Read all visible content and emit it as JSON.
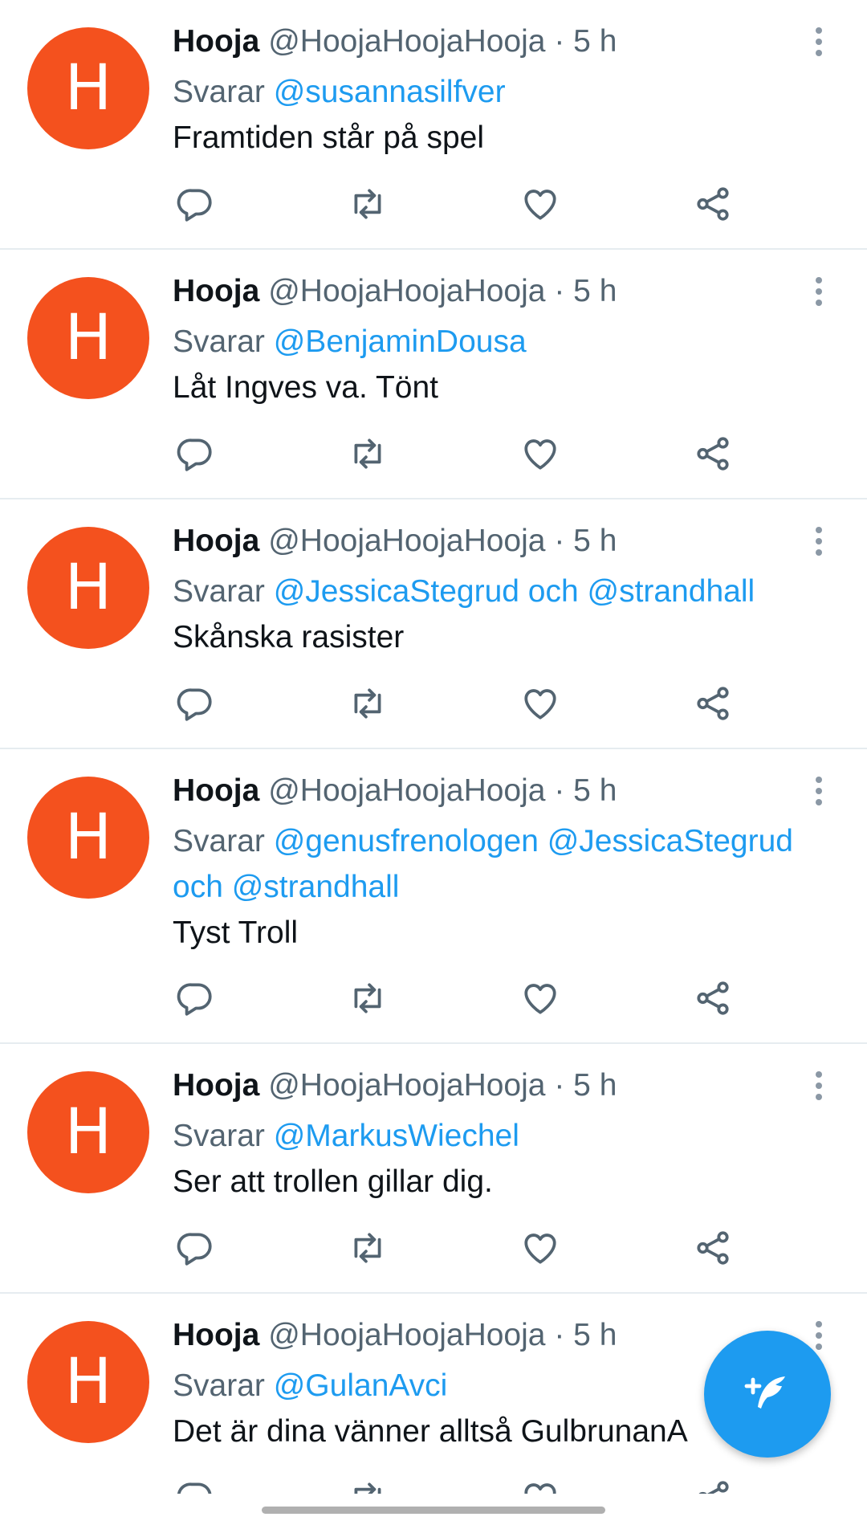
{
  "colors": {
    "avatar_bg": "#f4511e",
    "mention": "#1d9bf0",
    "secondary_text": "#536471",
    "primary_text": "#0f1419",
    "fab_bg": "#1d9bf0"
  },
  "reply_prefix": "Svarar",
  "tweets": [
    {
      "avatar_letter": "H",
      "display_name": "Hooja",
      "handle": "@HoojaHoojaHooja",
      "separator": "·",
      "time": "5 h",
      "replying_to": "@susannasilfver",
      "text": "Framtiden står på spel"
    },
    {
      "avatar_letter": "H",
      "display_name": "Hooja",
      "handle": "@HoojaHoojaHooja",
      "separator": "·",
      "time": "5 h",
      "replying_to": "@BenjaminDousa",
      "text": "Låt Ingves va. Tönt"
    },
    {
      "avatar_letter": "H",
      "display_name": "Hooja",
      "handle": "@HoojaHoojaHooja",
      "separator": "·",
      "time": "5 h",
      "replying_to": "@JessicaStegrud och @strandhall",
      "text": "Skånska rasister"
    },
    {
      "avatar_letter": "H",
      "display_name": "Hooja",
      "handle": "@HoojaHoojaHooja",
      "separator": "·",
      "time": "5 h",
      "replying_to": "@genusfrenologen @JessicaStegrud och @strandhall",
      "text": "Tyst Troll"
    },
    {
      "avatar_letter": "H",
      "display_name": "Hooja",
      "handle": "@HoojaHoojaHooja",
      "separator": "·",
      "time": "5 h",
      "replying_to": "@MarkusWiechel",
      "text": "Ser att trollen gillar dig."
    },
    {
      "avatar_letter": "H",
      "display_name": "Hooja",
      "handle": "@HoojaHoojaHooja",
      "separator": "·",
      "time": "5 h",
      "replying_to": "@GulanAvci",
      "text": "Det är dina vänner alltså GulbrunanA"
    }
  ],
  "icons": {
    "more": "more-vertical-icon",
    "reply": "reply-icon",
    "retweet": "retweet-icon",
    "like": "heart-icon",
    "share": "share-icon",
    "compose": "compose-tweet-icon"
  }
}
